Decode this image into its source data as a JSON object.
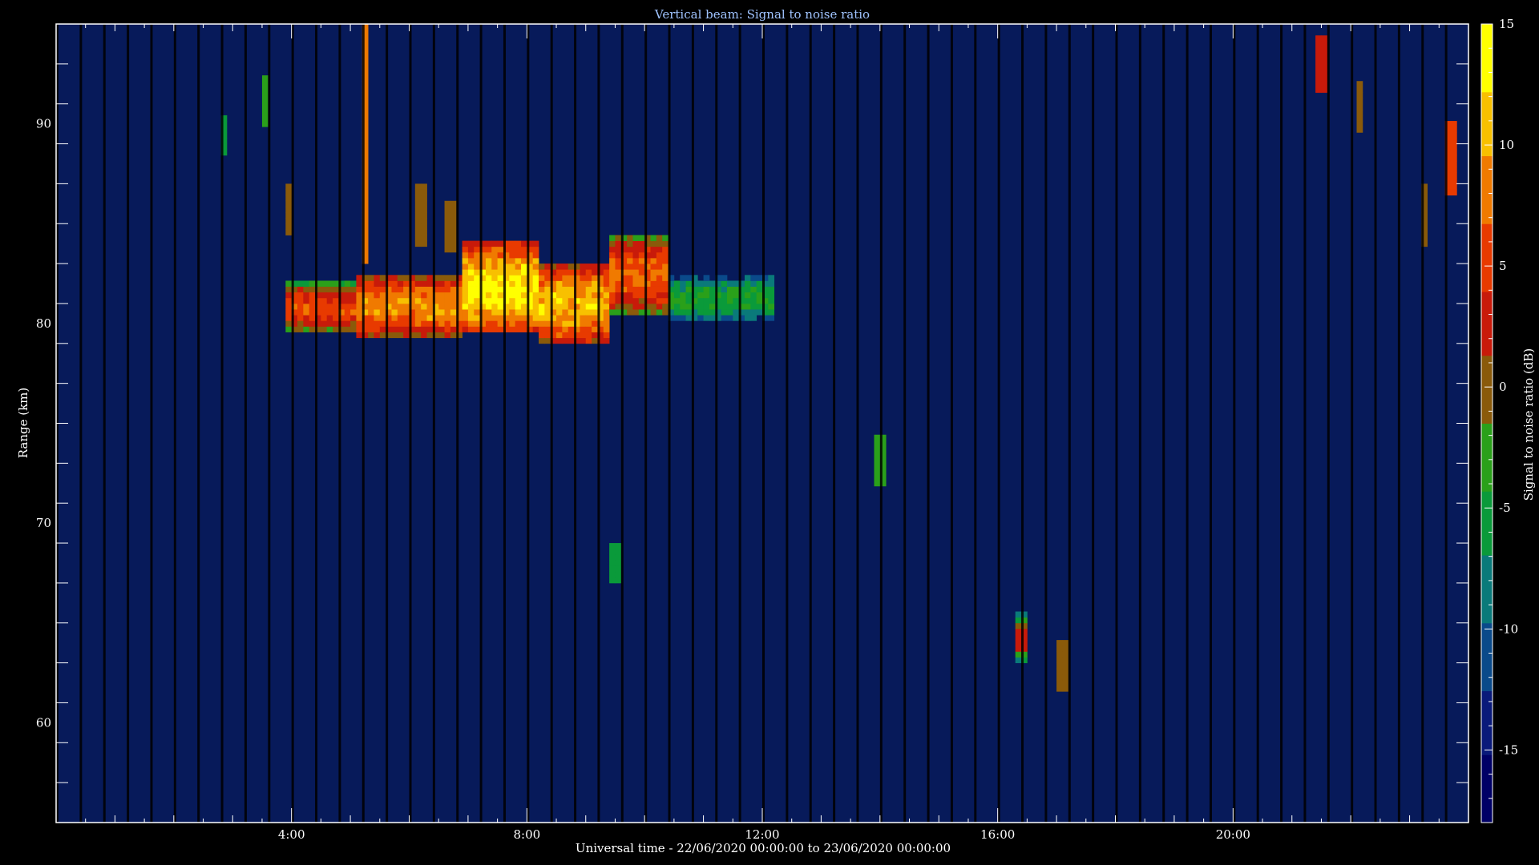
{
  "chart_data": {
    "type": "heatmap",
    "title": "Vertical beam: Signal to noise ratio",
    "xlabel": "Universal time - 22/06/2020 00:00:00 to 23/06/2020 00:00:00",
    "ylabel": "Range (km)",
    "colorbar_label": "Signal to noise ratio (dB)",
    "x_unit": "hours UT",
    "xlim": [
      0,
      24
    ],
    "ylim": [
      55,
      95
    ],
    "clim": [
      -18,
      15
    ],
    "x_ticks": [
      {
        "value": 4,
        "label": "4:00"
      },
      {
        "value": 8,
        "label": "8:00"
      },
      {
        "value": 12,
        "label": "12:00"
      },
      {
        "value": 16,
        "label": "16:00"
      },
      {
        "value": 20,
        "label": "20:00"
      }
    ],
    "y_ticks": [
      {
        "value": 60,
        "label": "60"
      },
      {
        "value": 70,
        "label": "70"
      },
      {
        "value": 80,
        "label": "80"
      },
      {
        "value": 90,
        "label": "90"
      }
    ],
    "colorbar_ticks": [
      {
        "value": 15,
        "label": "15"
      },
      {
        "value": 10,
        "label": "10"
      },
      {
        "value": 5,
        "label": "5"
      },
      {
        "value": 0,
        "label": "0"
      },
      {
        "value": -5,
        "label": "-5"
      },
      {
        "value": -10,
        "label": "-10"
      },
      {
        "value": -15,
        "label": "-15"
      }
    ],
    "background_snr": -14,
    "echo_regions": [
      {
        "t_start": 3.9,
        "t_end": 5.1,
        "range_low": 79.5,
        "range_high": 82,
        "snr": 6
      },
      {
        "t_start": 5.1,
        "t_end": 6.9,
        "range_low": 79.3,
        "range_high": 82.5,
        "snr": 9
      },
      {
        "t_start": 6.9,
        "t_end": 8.2,
        "range_low": 79.5,
        "range_high": 84,
        "snr": 13
      },
      {
        "t_start": 8.2,
        "t_end": 9.4,
        "range_low": 79,
        "range_high": 83,
        "snr": 11
      },
      {
        "t_start": 9.4,
        "t_end": 10.4,
        "range_low": 80.5,
        "range_high": 84.5,
        "snr": 7
      },
      {
        "t_start": 10.4,
        "t_end": 12.2,
        "range_low": 80,
        "range_high": 82.5,
        "snr": -4
      },
      {
        "t_start": 16.3,
        "t_end": 16.5,
        "range_low": 63,
        "range_high": 65.5,
        "snr": 2
      }
    ],
    "spikes": [
      {
        "t": 5.25,
        "range_low": 83,
        "range_high": 95,
        "snr": 8
      },
      {
        "t": 3.55,
        "range_low": 90,
        "range_high": 92.5,
        "snr": -3
      },
      {
        "t": 2.85,
        "range_low": 88.5,
        "range_high": 90.5,
        "snr": -6
      },
      {
        "t": 3.95,
        "range_low": 84.5,
        "range_high": 87,
        "snr": 1
      },
      {
        "t": 6.2,
        "range_low": 84,
        "range_high": 87,
        "snr": 0
      },
      {
        "t": 6.7,
        "range_low": 83.5,
        "range_high": 86,
        "snr": 0
      },
      {
        "t": 21.5,
        "range_low": 91.5,
        "range_high": 94.5,
        "snr": 2
      },
      {
        "t": 22.15,
        "range_low": 89.5,
        "range_high": 92,
        "snr": 0
      },
      {
        "t": 23.7,
        "range_low": 86.5,
        "range_high": 90,
        "snr": 6
      },
      {
        "t": 17.1,
        "range_low": 61.5,
        "range_high": 64,
        "snr": 0
      },
      {
        "t": 23.25,
        "range_low": 84,
        "range_high": 87,
        "snr": -1
      },
      {
        "t": 9.5,
        "range_low": 67,
        "range_high": 69,
        "snr": -7
      },
      {
        "t": 14.0,
        "range_low": 72,
        "range_high": 74.5,
        "snr": -3
      }
    ],
    "colormap": [
      "#000066",
      "#0a1a7a",
      "#0a4a8a",
      "#0a7a7a",
      "#0a9a3a",
      "#2aa01a",
      "#8a5a0a",
      "#c81a0a",
      "#e83a00",
      "#f07a00",
      "#f8c000",
      "#ffff00"
    ]
  }
}
